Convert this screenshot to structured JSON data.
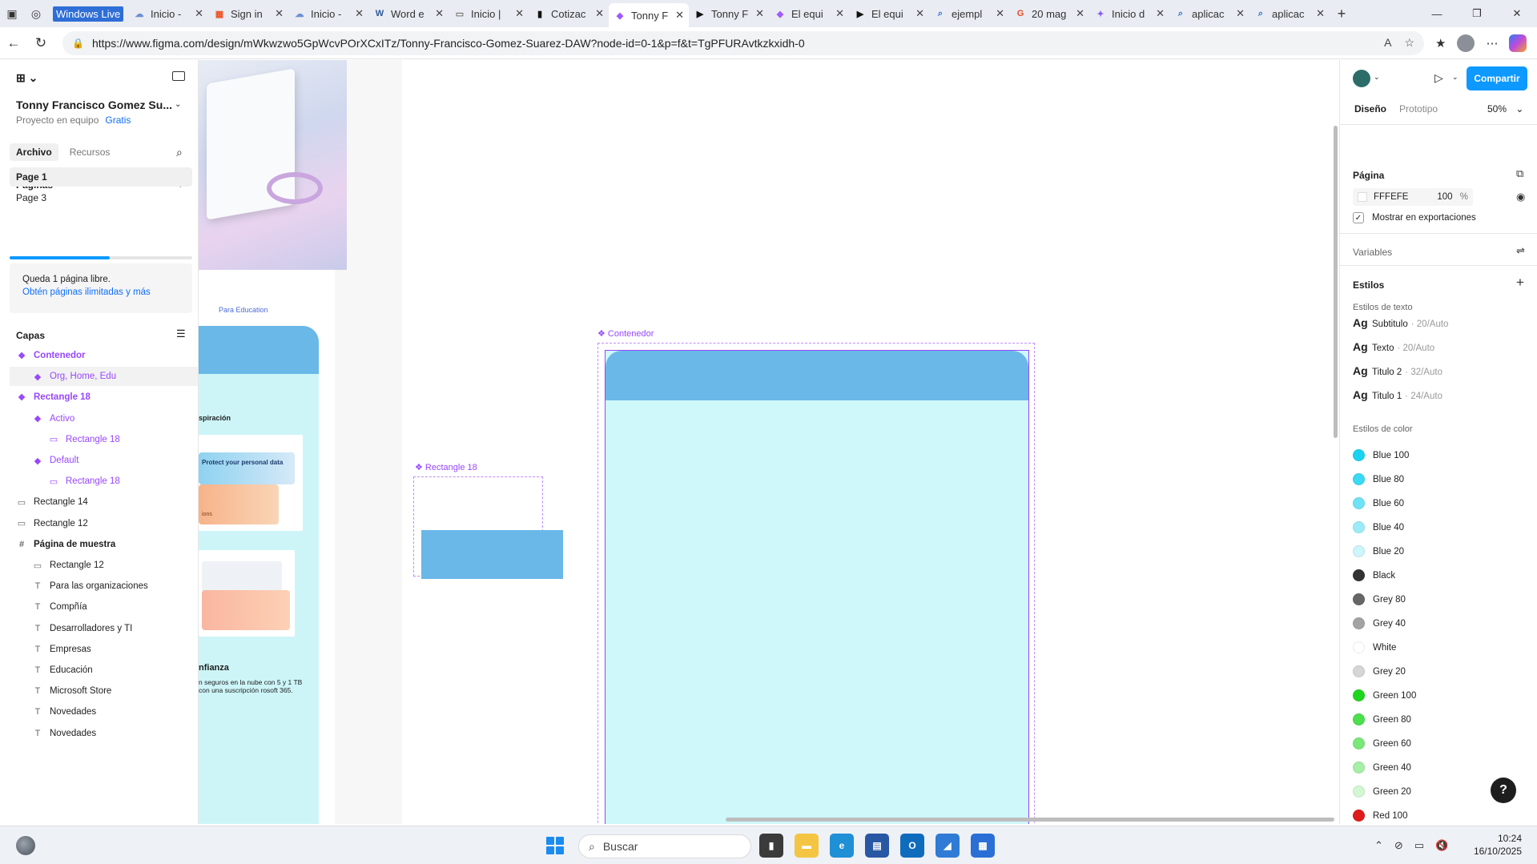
{
  "browser": {
    "tabs": [
      {
        "title": "Windows Live",
        "fav": "",
        "fav_color": "#2e6ed6"
      },
      {
        "title": "Inicio -",
        "fav": "☁",
        "fav_color": "#6b8fd6"
      },
      {
        "title": "Sign in",
        "fav": "▦",
        "fav_color": "#f25022"
      },
      {
        "title": "Inicio -",
        "fav": "☁",
        "fav_color": "#6b8fd6"
      },
      {
        "title": "Word e",
        "fav": "W",
        "fav_color": "#2b579a"
      },
      {
        "title": "Inicio |",
        "fav": "▭",
        "fav_color": "#777777"
      },
      {
        "title": "Cotizac",
        "fav": "▮",
        "fav_color": "#111111"
      },
      {
        "title": "Tonny F",
        "fav": "◆",
        "fav_color": "#a259ff"
      },
      {
        "title": "Tonny F",
        "fav": "▶",
        "fav_color": "#111111"
      },
      {
        "title": "El equi",
        "fav": "◆",
        "fav_color": "#a259ff"
      },
      {
        "title": "El equi",
        "fav": "▶",
        "fav_color": "#111111"
      },
      {
        "title": "ejempl",
        "fav": "⌕",
        "fav_color": "#2e6ed6"
      },
      {
        "title": "20 mag",
        "fav": "G",
        "fav_color": "#e44d26"
      },
      {
        "title": "Inicio d",
        "fav": "✦",
        "fav_color": "#8a5cf6"
      },
      {
        "title": "aplicac",
        "fav": "⌕",
        "fav_color": "#2e6ed6"
      },
      {
        "title": "aplicac",
        "fav": "⌕",
        "fav_color": "#2e6ed6"
      }
    ],
    "active_tab_index": 7,
    "url": "https://www.figma.com/design/mWkwzwo5GpWcvPOrXCxITz/Tonny-Francisco-Gomez-Suarez-DAW?node-id=0-1&p=f&t=TgPFURAvtkzkxidh-0"
  },
  "left_panel": {
    "project_name": "Tonny Francisco Gomez Su...",
    "project_sub": "Proyecto en equipo",
    "plan": "Gratis",
    "tab_file": "Archivo",
    "tab_assets": "Recursos",
    "pages_header": "Páginas",
    "pages": [
      "Page 1",
      "Page 3"
    ],
    "pages_progress": 0.55,
    "upsell_text": "Queda 1 página libre.",
    "upsell_link": "Obtén páginas ilimitadas y más",
    "layers_header": "Capas",
    "layers": [
      {
        "name": "Contenedor",
        "type": "component",
        "indent": 0,
        "bold": true
      },
      {
        "name": "Org, Home, Edu",
        "type": "instance",
        "indent": 1,
        "selected": true
      },
      {
        "name": "Rectangle 18",
        "type": "component",
        "indent": 0,
        "bold": true
      },
      {
        "name": "Activo",
        "type": "instance",
        "indent": 1
      },
      {
        "name": "Rectangle 18",
        "type": "rect-comp",
        "indent": 2
      },
      {
        "name": "Default",
        "type": "instance",
        "indent": 1
      },
      {
        "name": "Rectangle 18",
        "type": "rect-comp",
        "indent": 2
      },
      {
        "name": "Rectangle 14",
        "type": "rect",
        "indent": 0
      },
      {
        "name": "Rectangle 12",
        "type": "rect",
        "indent": 0
      },
      {
        "name": "Página de muestra",
        "type": "frame",
        "indent": 0,
        "bold": true
      },
      {
        "name": "Rectangle 12",
        "type": "rect",
        "indent": 1
      },
      {
        "name": "Para las organizaciones",
        "type": "text",
        "indent": 1
      },
      {
        "name": "Compñía",
        "type": "text",
        "indent": 1
      },
      {
        "name": "Desarrolladores y TI",
        "type": "text",
        "indent": 1
      },
      {
        "name": "Empresas",
        "type": "text",
        "indent": 1
      },
      {
        "name": "Educación",
        "type": "text",
        "indent": 1
      },
      {
        "name": "Microsoft Store",
        "type": "text",
        "indent": 1
      },
      {
        "name": "Novedades",
        "type": "text",
        "indent": 1
      },
      {
        "name": "Novedades",
        "type": "text",
        "indent": 1
      }
    ]
  },
  "canvas": {
    "preview": {
      "edu_label": "Para Education",
      "inspiration": "spiración",
      "protect_text": "Protect your personal data",
      "ions_text": "ions",
      "confidence_title": "nfianza",
      "confidence_body": "n seguros en la nube con 5 y 1 TB con una suscripción rosoft 365."
    },
    "rect18_label": "Rectangle 18",
    "contenedor_label": "Contenedor"
  },
  "toolbar": {
    "tools": [
      "move",
      "frame",
      "shape",
      "pen",
      "text",
      "comment",
      "actions",
      "draw",
      "design",
      "dev"
    ]
  },
  "right_panel": {
    "share": "Compartir",
    "tab_design": "Diseño",
    "tab_prototype": "Prototipo",
    "zoom": "50%",
    "page_header": "Página",
    "bg_hex": "FFFEFE",
    "bg_opacity": "100",
    "bg_unit": "%",
    "show_exports": "Mostrar en exportaciones",
    "variables": "Variables",
    "styles": "Estilos",
    "text_styles_header": "Estilos de texto",
    "text_styles": [
      {
        "ag": "Ag",
        "name": "Subtitulo",
        "meta": "· 20/Auto"
      },
      {
        "ag": "Ag",
        "name": "Texto",
        "meta": "· 20/Auto"
      },
      {
        "ag": "Ag",
        "name": "Titulo 2",
        "meta": "· 32/Auto"
      },
      {
        "ag": "Ag",
        "name": "Titulo 1",
        "meta": "· 24/Auto"
      }
    ],
    "color_styles_header": "Estilos de color",
    "color_styles": [
      {
        "name": "Blue 100",
        "color": "#1ad3f2"
      },
      {
        "name": "Blue 80",
        "color": "#3ad9f5"
      },
      {
        "name": "Blue 60",
        "color": "#6ee3f7"
      },
      {
        "name": "Blue 40",
        "color": "#9bebf9"
      },
      {
        "name": "Blue 20",
        "color": "#cdf5fc"
      },
      {
        "name": "Black",
        "color": "#333333"
      },
      {
        "name": "Grey 80",
        "color": "#666666"
      },
      {
        "name": "Grey 40",
        "color": "#a3a3a3"
      },
      {
        "name": "White",
        "color": "#ffffff"
      },
      {
        "name": "Grey 20",
        "color": "#d6d6d6"
      },
      {
        "name": "Green 100",
        "color": "#1fd61f"
      },
      {
        "name": "Green 80",
        "color": "#4ddf4d"
      },
      {
        "name": "Green 60",
        "color": "#7ae77a"
      },
      {
        "name": "Green 40",
        "color": "#a6efa6"
      },
      {
        "name": "Green 20",
        "color": "#d3f7d3"
      },
      {
        "name": "Red 100",
        "color": "#e01b1b"
      }
    ],
    "help": "?"
  },
  "taskbar": {
    "search_placeholder": "Buscar",
    "time": "10:24",
    "date": "16/10/2025"
  },
  "colors": {
    "accent": "#0d99ff",
    "component": "#9747ff",
    "frame_fill": "#cff8fb",
    "frame_header": "#6ab8e8"
  }
}
